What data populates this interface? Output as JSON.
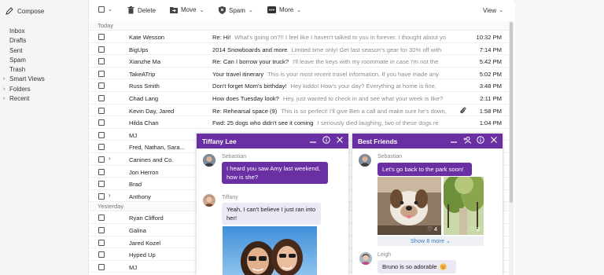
{
  "sidebar": {
    "compose_label": "Compose",
    "items": [
      {
        "label": "Inbox",
        "chevron": false
      },
      {
        "label": "Drafts",
        "chevron": false
      },
      {
        "label": "Sent",
        "chevron": false
      },
      {
        "label": "Spam",
        "chevron": false
      },
      {
        "label": "Trash",
        "chevron": false
      },
      {
        "label": "Smart Views",
        "chevron": true
      },
      {
        "label": "Folders",
        "chevron": true
      },
      {
        "label": "Recent",
        "chevron": true
      }
    ]
  },
  "toolbar": {
    "delete_label": "Delete",
    "move_label": "Move",
    "spam_label": "Spam",
    "more_label": "More",
    "view_label": "View"
  },
  "sections": {
    "today": "Today",
    "yesterday": "Yesterday"
  },
  "messages_today": [
    {
      "sender": "Kate Wesson",
      "subject": "Re: Hi!",
      "preview": "What's going on?!! I feel like I haven't talked to you in forever. I thought about yo",
      "time": "10:32 PM",
      "expand": false,
      "attachment": false
    },
    {
      "sender": "BigUps",
      "subject": "2014 Snowboards and more",
      "preview": "Limited time only! Get last season's gear for 30% off with",
      "time": "7:14 PM",
      "expand": false,
      "attachment": false
    },
    {
      "sender": "Xianzhe Ma",
      "subject": "Re: Can I borrow your truck?",
      "preview": "I'll leave the keys with my roommate in case I'm not the",
      "time": "5:42 PM",
      "expand": false,
      "attachment": false
    },
    {
      "sender": "TakeATrip",
      "subject": "Your travel itinerary",
      "preview": "This is your most recent travel information. If you have made any",
      "time": "5:02 PM",
      "expand": false,
      "attachment": false
    },
    {
      "sender": "Russ Smith",
      "subject": "Don't forget Mom's birthday!",
      "preview": "Hey kiddo! How's your day? Everything at home is fine,",
      "time": "3:48 PM",
      "expand": false,
      "attachment": false
    },
    {
      "sender": "Chad Lang",
      "subject": "How does Tuesday look?",
      "preview": "Hey, just wanted to check in and see what your week is like?",
      "time": "2:11 PM",
      "expand": false,
      "attachment": false
    },
    {
      "sender": "Kevin Day, Jared",
      "subject": "Re: Rehearsal space (9)",
      "preview": "This is so perfect! I'll give Ben a call and make sure he's down,",
      "time": "1:58 PM",
      "expand": false,
      "attachment": true
    },
    {
      "sender": "Hilda Chan",
      "subject": "Fwd: 25 dogs who didn't see it coming",
      "preview": "I seriously died laughing, two of these dogs re",
      "time": "1:04 PM",
      "expand": false,
      "attachment": false
    },
    {
      "sender": "MJ",
      "subject": "",
      "preview": "",
      "time": "",
      "expand": false,
      "attachment": false
    },
    {
      "sender": "Fred, Nathan, Sara...",
      "subject": "",
      "preview": "",
      "time": "",
      "expand": false,
      "attachment": false
    },
    {
      "sender": "Canines and Co.",
      "subject": "",
      "preview": "",
      "time": "",
      "expand": true,
      "attachment": false
    },
    {
      "sender": "Jon Herron",
      "subject": "",
      "preview": "",
      "time": "",
      "expand": false,
      "attachment": false
    },
    {
      "sender": "Brad",
      "subject": "",
      "preview": "",
      "time": "",
      "expand": false,
      "attachment": false
    },
    {
      "sender": "Anthony",
      "subject": "",
      "preview": "",
      "time": "",
      "expand": true,
      "attachment": false
    }
  ],
  "messages_yesterday": [
    {
      "sender": "Ryan Clifford",
      "subject": "",
      "preview": "",
      "time": "",
      "expand": false
    },
    {
      "sender": "Galina",
      "subject": "",
      "preview": "",
      "time": "",
      "expand": false
    },
    {
      "sender": "Jared Kozel",
      "subject": "",
      "preview": "",
      "time": "",
      "expand": false
    },
    {
      "sender": "Hyped Up",
      "subject": "",
      "preview": "",
      "time": "",
      "expand": false
    },
    {
      "sender": "MJ",
      "subject": "",
      "preview": "",
      "time": "",
      "expand": false
    }
  ],
  "chat1": {
    "title": "Tiffany Lee",
    "msg1_name": "Sebastian",
    "msg1_text": "I heard you saw Amy last weekend, how is she?",
    "msg2_name": "Tiffany",
    "msg2_text": "Yeah, I can't believe I just ran into her!"
  },
  "chat2": {
    "title": "Best Friends",
    "msg1_name": "Sebastian",
    "msg1_text": "Let's go back to the park soon!",
    "photo1_count": "4",
    "photo2_count": "2",
    "show_more": "Show 8 more",
    "msg2_name": "Leigh",
    "msg2_text": "Bruno is so adorable"
  },
  "colors": {
    "accent": "#6a2fa3",
    "bubble_light": "#ebe7f3"
  }
}
